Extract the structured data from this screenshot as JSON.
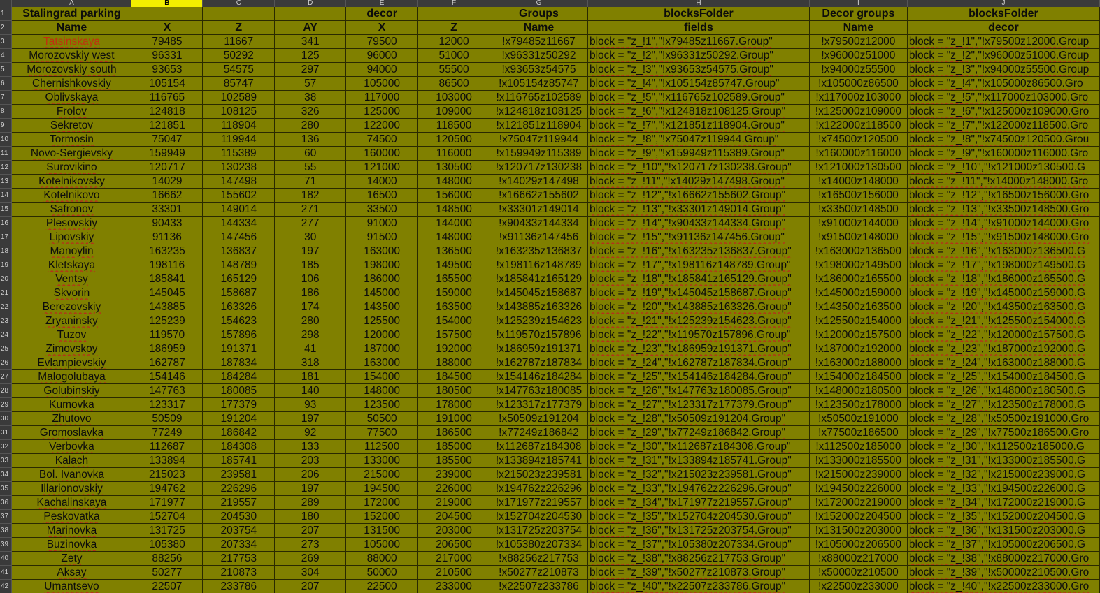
{
  "column_letters": [
    "A",
    "B",
    "C",
    "D",
    "E",
    "F",
    "G",
    "H",
    "I",
    "J"
  ],
  "selected_column": "B",
  "header_row_1": [
    "Stalingrad parking",
    "",
    "",
    "",
    "decor",
    "",
    "Groups",
    "blocksFolder",
    "Decor groups",
    "blocksFolder"
  ],
  "header_row_2": [
    "Name",
    "X",
    "Z",
    "AY",
    "X",
    "Z",
    "Name",
    "fields",
    "Name",
    "decor"
  ],
  "rows": [
    {
      "n": "3",
      "name": "Tatsinskaya",
      "x": "79485",
      "z": "11667",
      "ay": "341",
      "dx": "79500",
      "dz": "12000",
      "g": "!x79485z11667",
      "f": "block = \"z_!1\",\"!x79485z11667.Group\"",
      "dg": "!x79500z12000",
      "df": "block = \"z_!1\",\"!x79500z12000.Group"
    },
    {
      "n": "4",
      "name": "Morozovskiy west",
      "x": "96331",
      "z": "50292",
      "ay": "125",
      "dx": "96000",
      "dz": "51000",
      "g": "!x96331z50292",
      "f": "block = \"z_!2\",\"!x96331z50292.Group\"",
      "dg": "!x96000z51000",
      "df": "block = \"z_!2\",\"!x96000z51000.Group"
    },
    {
      "n": "5",
      "name": "Morozovskiy south",
      "x": "93653",
      "z": "54575",
      "ay": "297",
      "dx": "94000",
      "dz": "55500",
      "g": "!x93653z54575",
      "f": "block = \"z_!3\",\"!x93653z54575.Group\"",
      "dg": "!x94000z55500",
      "df": "block = \"z_!3\",\"!x94000z55500.Group"
    },
    {
      "n": "6",
      "name": "Chernishkovskiy",
      "x": "105154",
      "z": "85747",
      "ay": "57",
      "dx": "105000",
      "dz": "86500",
      "g": "!x105154z85747",
      "f": "block = \"z_!4\",\"!x105154z85747.Group\"",
      "dg": "!x105000z86500",
      "df": "block = \"z_!4\",\"!x105000z86500.Gro"
    },
    {
      "n": "7",
      "name": "Oblivskaya",
      "x": "116765",
      "z": "102589",
      "ay": "38",
      "dx": "117000",
      "dz": "103000",
      "g": "!x116765z102589",
      "f": "block = \"z_!5\",\"!x116765z102589.Group\"",
      "dg": "!x117000z103000",
      "df": "block = \"z_!5\",\"!x117000z103000.Gro"
    },
    {
      "n": "8",
      "name": "Frolov",
      "x": "124818",
      "z": "108125",
      "ay": "326",
      "dx": "125000",
      "dz": "109000",
      "g": "!x124818z108125",
      "f": "block = \"z_!6\",\"!x124818z108125.Group\"",
      "dg": "!x125000z109000",
      "df": "block = \"z_!6\",\"!x125000z109000.Gro"
    },
    {
      "n": "9",
      "name": "Sekretov",
      "x": "121851",
      "z": "118904",
      "ay": "280",
      "dx": "122000",
      "dz": "118500",
      "g": "!x121851z118904",
      "f": "block = \"z_!7\",\"!x121851z118904.Group\"",
      "dg": "!x122000z118500",
      "df": "block = \"z_!7\",\"!x122000z118500.Gro"
    },
    {
      "n": "10",
      "name": "Tormosin",
      "x": "75047",
      "z": "119944",
      "ay": "136",
      "dx": "74500",
      "dz": "120500",
      "g": "!x75047z119944",
      "f": "block = \"z_!8\",\"!x75047z119944.Group\"",
      "dg": "!x74500z120500",
      "df": "block = \"z_!8\",\"!x74500z120500.Grou"
    },
    {
      "n": "11",
      "name": "Novo-Sergievsky",
      "x": "159949",
      "z": "115389",
      "ay": "60",
      "dx": "160000",
      "dz": "116000",
      "g": "!x159949z115389",
      "f": "block = \"z_!9\",\"!x159949z115389.Group\"",
      "dg": "!x160000z116000",
      "df": "block = \"z_!9\",\"!x160000z116000.Gro"
    },
    {
      "n": "12",
      "name": "Surovikino",
      "x": "120717",
      "z": "130238",
      "ay": "55",
      "dx": "121000",
      "dz": "130500",
      "g": "!x120717z130238",
      "f": "block = \"z_!10\",\"!x120717z130238.Group\"",
      "dg": "!x121000z130500",
      "df": "block = \"z_!10\",\"!x121000z130500.G"
    },
    {
      "n": "13",
      "name": "Kotelnikovsky",
      "x": "14029",
      "z": "147498",
      "ay": "71",
      "dx": "14000",
      "dz": "148000",
      "g": "!x14029z147498",
      "f": "block = \"z_!11\",\"!x14029z147498.Group\"",
      "dg": "!x14000z148000",
      "df": "block = \"z_!11\",\"!x14000z148000.Gro"
    },
    {
      "n": "14",
      "name": "Kotelnikovo",
      "x": "16662",
      "z": "155602",
      "ay": "182",
      "dx": "16500",
      "dz": "156000",
      "g": "!x16662z155602",
      "f": "block = \"z_!12\",\"!x16662z155602.Group\"",
      "dg": "!x16500z156000",
      "df": "block = \"z_!12\",\"!x16500z156000.Gro"
    },
    {
      "n": "15",
      "name": "Safronov",
      "x": "33301",
      "z": "149014",
      "ay": "271",
      "dx": "33500",
      "dz": "148500",
      "g": "!x33301z149014",
      "f": "block = \"z_!13\",\"!x33301z149014.Group\"",
      "dg": "!x33500z148500",
      "df": "block = \"z_!13\",\"!x33500z148500.Gro"
    },
    {
      "n": "16",
      "name": "Plesovskiy",
      "x": "90433",
      "z": "144334",
      "ay": "277",
      "dx": "91000",
      "dz": "144000",
      "g": "!x90433z144334",
      "f": "block = \"z_!14\",\"!x90433z144334.Group\"",
      "dg": "!x91000z144000",
      "df": "block = \"z_!14\",\"!x91000z144000.Gro"
    },
    {
      "n": "17",
      "name": "Lipovskiy",
      "x": "91136",
      "z": "147456",
      "ay": "30",
      "dx": "91500",
      "dz": "148000",
      "g": "!x91136z147456",
      "f": "block = \"z_!15\",\"!x91136z147456.Group\"",
      "dg": "!x91500z148000",
      "df": "block = \"z_!15\",\"!x91500z148000.Gro"
    },
    {
      "n": "18",
      "name": "Manoylin",
      "x": "163235",
      "z": "136837",
      "ay": "197",
      "dx": "163000",
      "dz": "136500",
      "g": "!x163235z136837",
      "f": "block = \"z_!16\",\"!x163235z136837.Group\"",
      "dg": "!x163000z136500",
      "df": "block = \"z_!16\",\"!x163000z136500.G"
    },
    {
      "n": "19",
      "name": "Kletskaya",
      "x": "198116",
      "z": "148789",
      "ay": "185",
      "dx": "198000",
      "dz": "149500",
      "g": "!x198116z148789",
      "f": "block = \"z_!17\",\"!x198116z148789.Group\"",
      "dg": "!x198000z149500",
      "df": "block = \"z_!17\",\"!x198000z149500.G"
    },
    {
      "n": "20",
      "name": "Ventsy",
      "x": "185841",
      "z": "165129",
      "ay": "106",
      "dx": "186000",
      "dz": "165500",
      "g": "!x185841z165129",
      "f": "block = \"z_!18\",\"!x185841z165129.Group\"",
      "dg": "!x186000z165500",
      "df": "block = \"z_!18\",\"!x186000z165500.G"
    },
    {
      "n": "21",
      "name": "Skvorin",
      "x": "145045",
      "z": "158687",
      "ay": "186",
      "dx": "145000",
      "dz": "159000",
      "g": "!x145045z158687",
      "f": "block = \"z_!19\",\"!x145045z158687.Group\"",
      "dg": "!x145000z159000",
      "df": "block = \"z_!19\",\"!x145000z159000.G"
    },
    {
      "n": "22",
      "name": "Berezovskiy",
      "x": "143885",
      "z": "163326",
      "ay": "174",
      "dx": "143500",
      "dz": "163500",
      "g": "!x143885z163326",
      "f": "block = \"z_!20\",\"!x143885z163326.Group\"",
      "dg": "!x143500z163500",
      "df": "block = \"z_!20\",\"!x143500z163500.G"
    },
    {
      "n": "23",
      "name": "Zryaninsky",
      "x": "125239",
      "z": "154623",
      "ay": "280",
      "dx": "125500",
      "dz": "154000",
      "g": "!x125239z154623",
      "f": "block = \"z_!21\",\"!x125239z154623.Group\"",
      "dg": "!x125500z154000",
      "df": "block = \"z_!21\",\"!x125500z154000.G"
    },
    {
      "n": "24",
      "name": "Tuzov",
      "x": "119570",
      "z": "157896",
      "ay": "298",
      "dx": "120000",
      "dz": "157500",
      "g": "!x119570z157896",
      "f": "block = \"z_!22\",\"!x119570z157896.Group\"",
      "dg": "!x120000z157500",
      "df": "block = \"z_!22\",\"!x120000z157500.G"
    },
    {
      "n": "25",
      "name": "Zimovskoy",
      "x": "186959",
      "z": "191371",
      "ay": "41",
      "dx": "187000",
      "dz": "192000",
      "g": "!x186959z191371",
      "f": "block = \"z_!23\",\"!x186959z191371.Group\"",
      "dg": "!x187000z192000",
      "df": "block = \"z_!23\",\"!x187000z192000.G"
    },
    {
      "n": "26",
      "name": "Evlampievskiy",
      "x": "162787",
      "z": "187834",
      "ay": "318",
      "dx": "163000",
      "dz": "188000",
      "g": "!x162787z187834",
      "f": "block = \"z_!24\",\"!x162787z187834.Group\"",
      "dg": "!x163000z188000",
      "df": "block = \"z_!24\",\"!x163000z188000.G"
    },
    {
      "n": "27",
      "name": "Malogolubaya",
      "x": "154146",
      "z": "184284",
      "ay": "181",
      "dx": "154000",
      "dz": "184500",
      "g": "!x154146z184284",
      "f": "block = \"z_!25\",\"!x154146z184284.Group\"",
      "dg": "!x154000z184500",
      "df": "block = \"z_!25\",\"!x154000z184500.G"
    },
    {
      "n": "28",
      "name": "Golubinskiy",
      "x": "147763",
      "z": "180085",
      "ay": "140",
      "dx": "148000",
      "dz": "180500",
      "g": "!x147763z180085",
      "f": "block = \"z_!26\",\"!x147763z180085.Group\"",
      "dg": "!x148000z180500",
      "df": "block = \"z_!26\",\"!x148000z180500.G"
    },
    {
      "n": "29",
      "name": "Kumovka",
      "x": "123317",
      "z": "177379",
      "ay": "93",
      "dx": "123500",
      "dz": "178000",
      "g": "!x123317z177379",
      "f": "block = \"z_!27\",\"!x123317z177379.Group\"",
      "dg": "!x123500z178000",
      "df": "block = \"z_!27\",\"!x123500z178000.G"
    },
    {
      "n": "30",
      "name": "Zhutovo",
      "x": "50509",
      "z": "191204",
      "ay": "197",
      "dx": "50500",
      "dz": "191000",
      "g": "!x50509z191204",
      "f": "block = \"z_!28\",\"!x50509z191204.Group\"",
      "dg": "!x50500z191000",
      "df": "block = \"z_!28\",\"!x50500z191000.Gro"
    },
    {
      "n": "31",
      "name": "Gromoslavka",
      "x": "77249",
      "z": "186842",
      "ay": "92",
      "dx": "77500",
      "dz": "186500",
      "g": "!x77249z186842",
      "f": "block = \"z_!29\",\"!x77249z186842.Group\"",
      "dg": "!x77500z186500",
      "df": "block = \"z_!29\",\"!x77500z186500.Gro"
    },
    {
      "n": "32",
      "name": "Verbovka",
      "x": "112687",
      "z": "184308",
      "ay": "133",
      "dx": "112500",
      "dz": "185000",
      "g": "!x112687z184308",
      "f": "block = \"z_!30\",\"!x112687z184308.Group\"",
      "dg": "!x112500z185000",
      "df": "block = \"z_!30\",\"!x112500z185000.G"
    },
    {
      "n": "33",
      "name": "Kalach",
      "x": "133894",
      "z": "185741",
      "ay": "203",
      "dx": "133000",
      "dz": "185500",
      "g": "!x133894z185741",
      "f": "block = \"z_!31\",\"!x133894z185741.Group\"",
      "dg": "!x133000z185500",
      "df": "block = \"z_!31\",\"!x133000z185500.G"
    },
    {
      "n": "34",
      "name": "Bol. Ivanovka",
      "x": "215023",
      "z": "239581",
      "ay": "206",
      "dx": "215000",
      "dz": "239000",
      "g": "!x215023z239581",
      "f": "block = \"z_!32\",\"!x215023z239581.Group\"",
      "dg": "!x215000z239000",
      "df": "block = \"z_!32\",\"!x215000z239000.G"
    },
    {
      "n": "35",
      "name": "Illarionovskiy",
      "x": "194762",
      "z": "226296",
      "ay": "197",
      "dx": "194500",
      "dz": "226000",
      "g": "!x194762z226296",
      "f": "block = \"z_!33\",\"!x194762z226296.Group\"",
      "dg": "!x194500z226000",
      "df": "block = \"z_!33\",\"!x194500z226000.G"
    },
    {
      "n": "36",
      "name": "Kachalinskaya",
      "x": "171977",
      "z": "219557",
      "ay": "289",
      "dx": "172000",
      "dz": "219000",
      "g": "!x171977z219557",
      "f": "block = \"z_!34\",\"!x171977z219557.Group\"",
      "dg": "!x172000z219000",
      "df": "block = \"z_!34\",\"!x172000z219000.G"
    },
    {
      "n": "37",
      "name": "Peskovatka",
      "x": "152704",
      "z": "204530",
      "ay": "180",
      "dx": "152000",
      "dz": "204500",
      "g": "!x152704z204530",
      "f": "block = \"z_!35\",\"!x152704z204530.Group\"",
      "dg": "!x152000z204500",
      "df": "block = \"z_!35\",\"!x152000z204500.G"
    },
    {
      "n": "38",
      "name": "Marinovka",
      "x": "131725",
      "z": "203754",
      "ay": "207",
      "dx": "131500",
      "dz": "203000",
      "g": "!x131725z203754",
      "f": "block = \"z_!36\",\"!x131725z203754.Group\"",
      "dg": "!x131500z203000",
      "df": "block = \"z_!36\",\"!x131500z203000.G"
    },
    {
      "n": "39",
      "name": "Buzinovka",
      "x": "105380",
      "z": "207334",
      "ay": "273",
      "dx": "105000",
      "dz": "206500",
      "g": "!x105380z207334",
      "f": "block = \"z_!37\",\"!x105380z207334.Group\"",
      "dg": "!x105000z206500",
      "df": "block = \"z_!37\",\"!x105000z206500.G"
    },
    {
      "n": "40",
      "name": "Zety",
      "x": "88256",
      "z": "217753",
      "ay": "269",
      "dx": "88000",
      "dz": "217000",
      "g": "!x88256z217753",
      "f": "block = \"z_!38\",\"!x88256z217753.Group\"",
      "dg": "!x88000z217000",
      "df": "block = \"z_!38\",\"!x88000z217000.Gro"
    },
    {
      "n": "41",
      "name": "Aksay",
      "x": "50277",
      "z": "210873",
      "ay": "304",
      "dx": "50000",
      "dz": "210500",
      "g": "!x50277z210873",
      "f": "block = \"z_!39\",\"!x50277z210873.Group\"",
      "dg": "!x50000z210500",
      "df": "block = \"z_!39\",\"!x50000z210500.Gro"
    },
    {
      "n": "42",
      "name": "Umantsevo",
      "x": "22507",
      "z": "233786",
      "ay": "207",
      "dx": "22500",
      "dz": "233000",
      "g": "!x22507z233786",
      "f": "block = \"z_!40\",\"!x22507z233786.Group\"",
      "dg": "!x22500z233000",
      "df": "block = \"z_!40\",\"!x22500z233000.Gro"
    }
  ]
}
